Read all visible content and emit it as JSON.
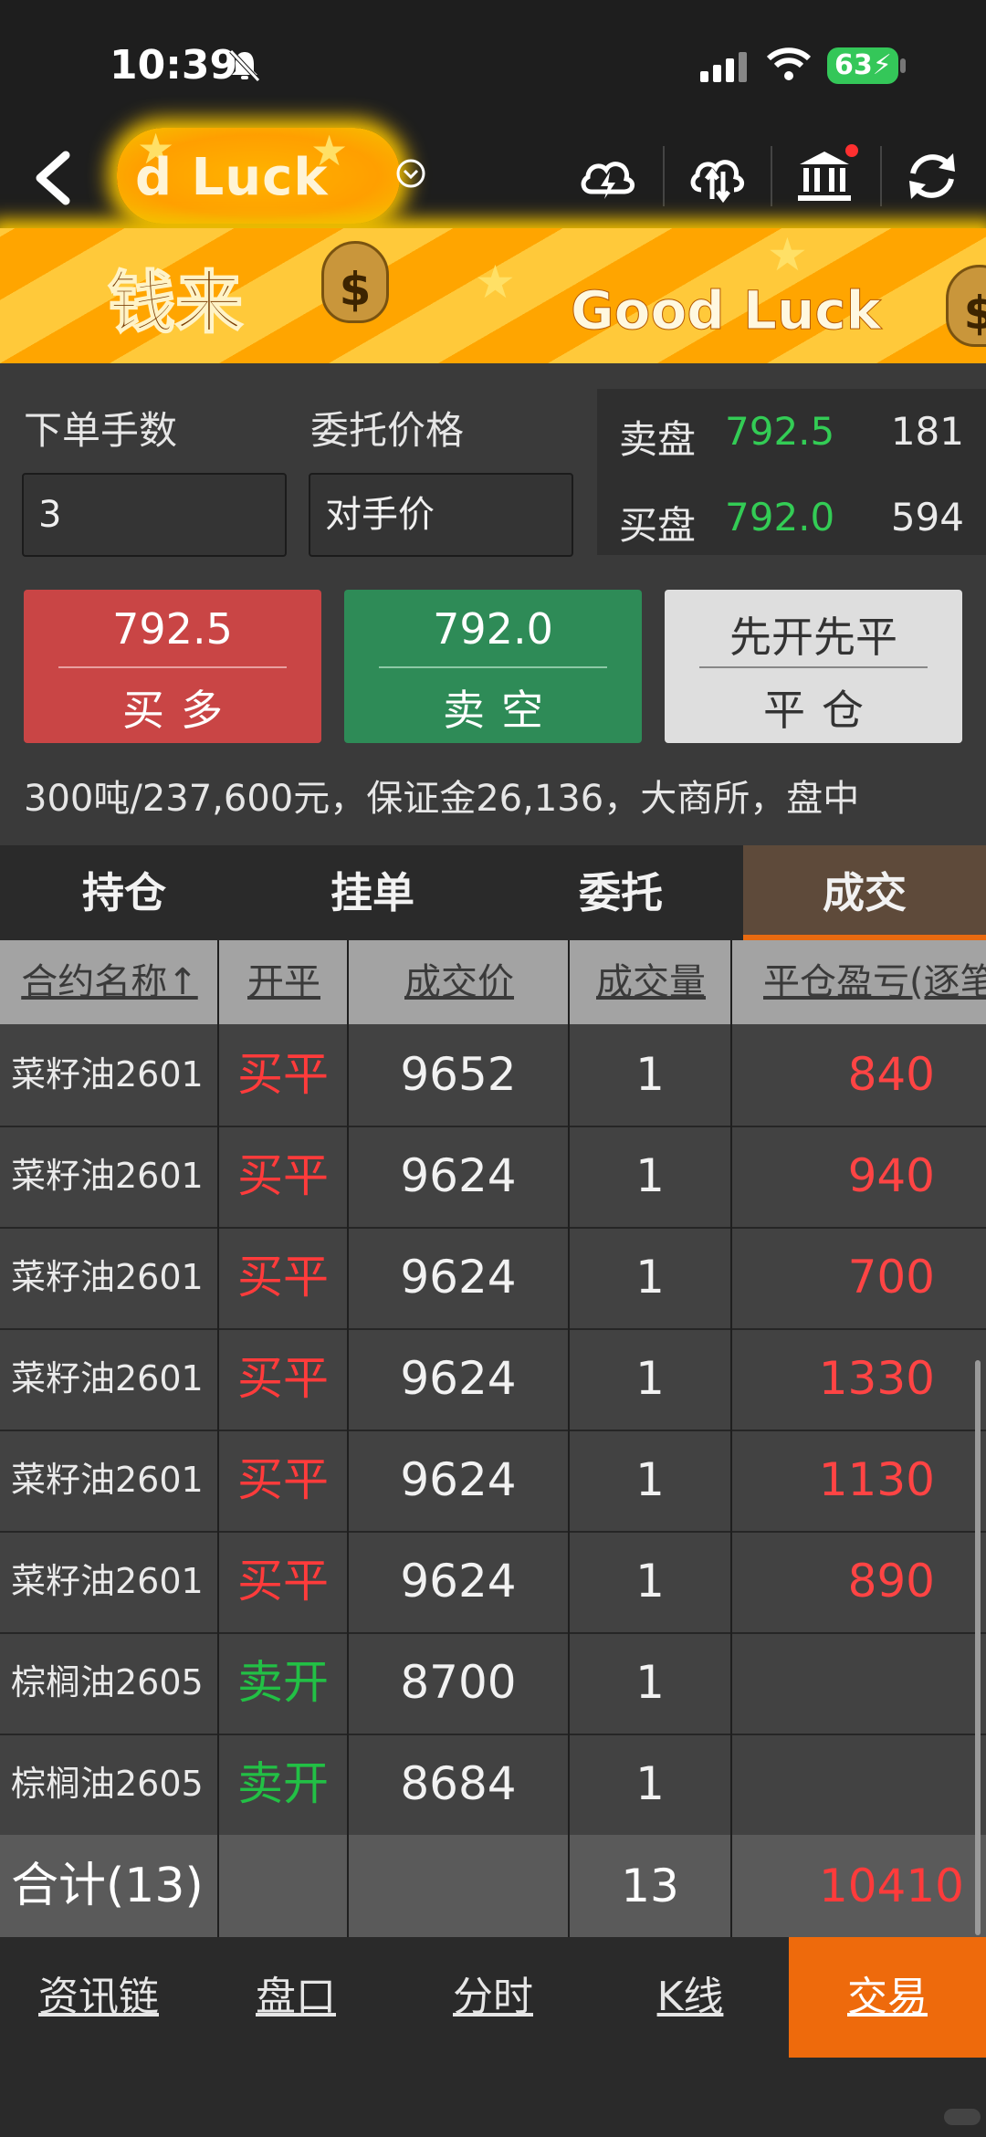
{
  "status_bar": {
    "time": "10:39",
    "battery": "63"
  },
  "header": {
    "banner_partial_title": "d Luck"
  },
  "banner": {
    "text_cn": "钱来",
    "text_en": "Good Luck",
    "bag_symbol": "$"
  },
  "order": {
    "qty_label": "下单手数",
    "price_label": "委托价格",
    "qty_value": "3",
    "price_value": "对手价",
    "ask_label": "卖盘",
    "ask_price": "792.5",
    "ask_volume": "181",
    "bid_label": "买盘",
    "bid_price": "792.0",
    "bid_volume": "594",
    "buy_price": "792.5",
    "buy_label": "买多",
    "sell_price": "792.0",
    "sell_label": "卖空",
    "close_top": "先开先平",
    "close_label": "平仓",
    "contract_info": "300吨/237,600元，保证金26,136，大商所，盘中"
  },
  "tabs": [
    "持仓",
    "挂单",
    "委托",
    "成交"
  ],
  "table": {
    "headers": [
      "合约名称↑",
      "开平",
      "成交价",
      "成交量",
      "平仓盈亏(逐笔"
    ],
    "rows": [
      {
        "name": "菜籽油2601",
        "kp": "买平",
        "price": "9652",
        "qty": "1",
        "pnl": "840"
      },
      {
        "name": "菜籽油2601",
        "kp": "买平",
        "price": "9624",
        "qty": "1",
        "pnl": "940"
      },
      {
        "name": "菜籽油2601",
        "kp": "买平",
        "price": "9624",
        "qty": "1",
        "pnl": "700"
      },
      {
        "name": "菜籽油2601",
        "kp": "买平",
        "price": "9624",
        "qty": "1",
        "pnl": "1330"
      },
      {
        "name": "菜籽油2601",
        "kp": "买平",
        "price": "9624",
        "qty": "1",
        "pnl": "1130"
      },
      {
        "name": "菜籽油2601",
        "kp": "买平",
        "price": "9624",
        "qty": "1",
        "pnl": "890"
      },
      {
        "name": "棕榈油2605",
        "kp": "卖开",
        "price": "8700",
        "qty": "1",
        "pnl": ""
      },
      {
        "name": "棕榈油2605",
        "kp": "卖开",
        "price": "8684",
        "qty": "1",
        "pnl": ""
      }
    ],
    "total_label": "合计(13)",
    "total_qty": "13",
    "total_pnl": "10410"
  },
  "bottom_nav": [
    "资讯链",
    "盘口",
    "分时",
    "K线",
    "交易"
  ],
  "colors": {
    "buy": "#c94545",
    "sell": "#2e8b57",
    "accent": "#ee6a0c",
    "profit": "#ff3b3b",
    "open_sell": "#22c045"
  }
}
